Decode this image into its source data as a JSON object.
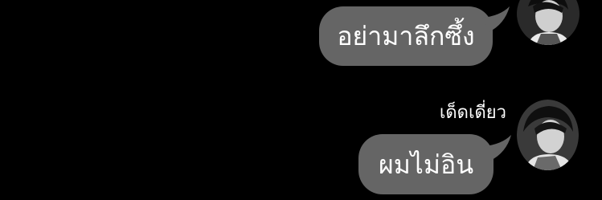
{
  "messages": [
    {
      "text": "อย่ามาลึกซึ้ง"
    },
    {
      "sender": "เด็ดเดี่ยว",
      "text": "ผมไม่อิน"
    }
  ],
  "colors": {
    "background": "#000000",
    "bubble": "#656565",
    "text": "#ffffff"
  },
  "icons": [
    "avatar-photo"
  ]
}
